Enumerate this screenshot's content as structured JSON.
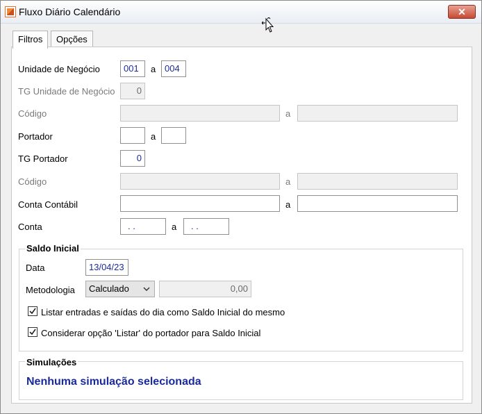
{
  "window": {
    "title": "Fluxo Diário Calendário",
    "close_label": "✕"
  },
  "tabs": [
    {
      "label": "Filtros"
    },
    {
      "label": "Opções"
    }
  ],
  "filtros": {
    "unidade": {
      "label": "Unidade de Negócio",
      "from": "001",
      "sep": "a",
      "to": "004"
    },
    "tg_unidade": {
      "label": "TG Unidade de Negócio",
      "value": "0"
    },
    "codigo1": {
      "label": "Código",
      "from": "",
      "sep": "a",
      "to": ""
    },
    "portador": {
      "label": "Portador",
      "from": "",
      "sep": "a",
      "to": ""
    },
    "tg_portador": {
      "label": "TG Portador",
      "value": "0"
    },
    "codigo2": {
      "label": "Código",
      "from": "",
      "sep": "a",
      "to": ""
    },
    "conta_contabil": {
      "label": "Conta Contábil",
      "from": "",
      "sep": "a",
      "to": ""
    },
    "conta": {
      "label": "Conta",
      "from": ". .",
      "sep": "a",
      "to": ". ."
    }
  },
  "saldo_inicial": {
    "title": "Saldo Inicial",
    "data_label": "Data",
    "data_value": "13/04/23",
    "metodologia_label": "Metodologia",
    "metodologia_value": "Calculado",
    "valor": "0,00",
    "check1": {
      "label": "Listar entradas e saídas do dia como Saldo Inicial do mesmo",
      "checked": true
    },
    "check2": {
      "label": "Considerar opção 'Listar' do portador para Saldo Inicial",
      "checked": true
    }
  },
  "simulacoes": {
    "title": "Simulações",
    "text": "Nenhuma simulação selecionada"
  },
  "colors": {
    "value_blue": "#1b2b9b",
    "simul_blue": "#1a2a9c",
    "close_red": "#c74a33"
  }
}
